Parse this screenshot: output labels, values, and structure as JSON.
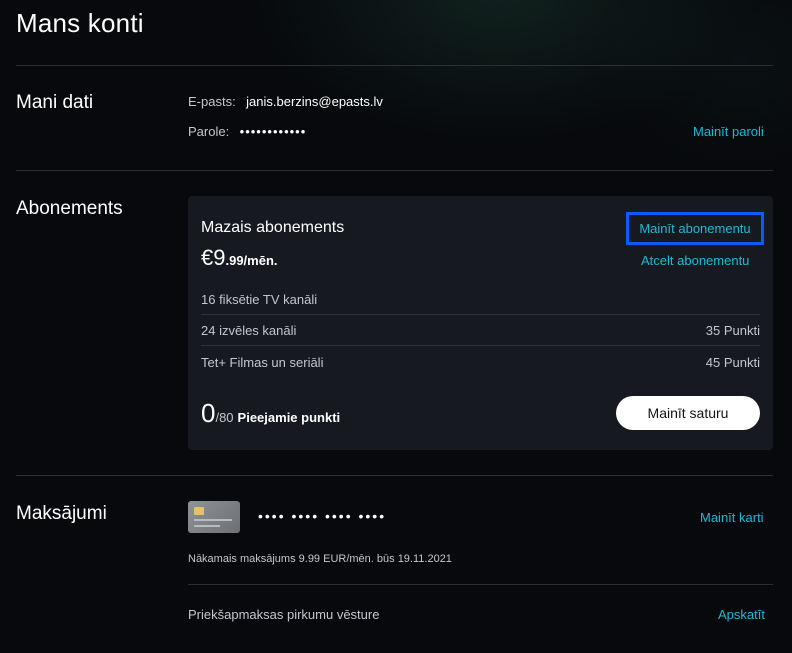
{
  "page": {
    "title": "Mans konti"
  },
  "my_data": {
    "title": "Mani dati",
    "email_label": "E-pasts:",
    "email_value": "janis.berzins@epasts.lv",
    "password_label": "Parole:",
    "password_value": "••••••••••••",
    "change_password": "Mainīt paroli"
  },
  "subscription": {
    "title": "Abonements",
    "plan_name": "Mazais abonements",
    "price_main": "€9",
    "price_sub": ".99/mēn.",
    "change_subscription": "Mainīt abonementu",
    "cancel_subscription": "Atcelt abonementu",
    "features": [
      {
        "name": "16 fiksētie TV kanāli",
        "points": ""
      },
      {
        "name": "24 izvēles kanāli",
        "points": "35 Punkti"
      },
      {
        "name": "Tet+ Filmas un seriāli",
        "points": "45 Punkti"
      }
    ],
    "points_current": "0",
    "points_total": "/80",
    "points_label": "Pieejamie punkti",
    "change_content": "Mainīt saturu"
  },
  "payments": {
    "title": "Maksājumi",
    "card_mask": "•••• •••• •••• ••••",
    "change_card": "Mainīt karti",
    "next_payment": "Nākamais maksājums 9.99 EUR/mēn. būs 19.11.2021",
    "history_label": "Priekšapmaksas pirkumu vēsture",
    "view": "Apskatīt"
  },
  "colors": {
    "accent_link": "#1fb7d8",
    "highlight_border": "#0a5cff",
    "background": "#07090c",
    "card_background": "#161a20"
  }
}
